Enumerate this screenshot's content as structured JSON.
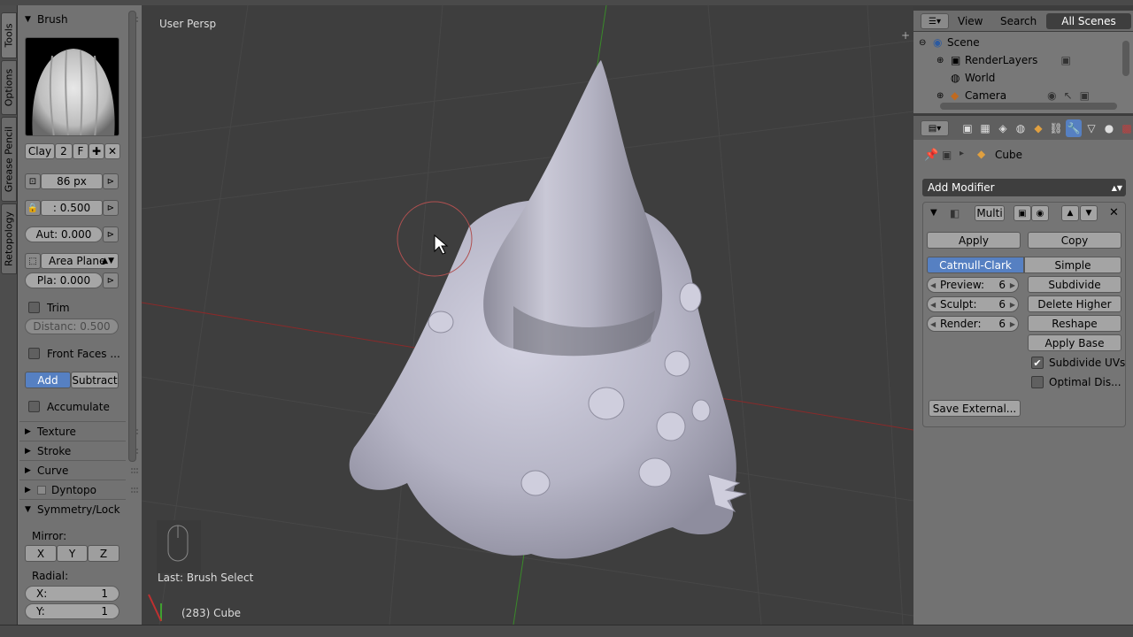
{
  "toolshelf": {
    "tabs": [
      "Tools",
      "Options",
      "Grease Pencil",
      "Retopology"
    ],
    "brush_panel": "Brush",
    "brush_name": "Clay",
    "brush_users": "2",
    "brush_fake": "F",
    "radius": "86 px",
    "strength": ": 0.500",
    "autosmooth": "Aut: 0.000",
    "sculpt_plane": "Area Plane",
    "plane_offset_label": "Pla:",
    "plane_offset_value": "0.000",
    "trim_label": "Trim",
    "distance": "Distanc: 0.500",
    "front_faces": "Front Faces ...",
    "add": "Add",
    "subtract": "Subtract",
    "accumulate": "Accumulate",
    "panels": [
      "Texture",
      "Stroke",
      "Curve",
      "Dyntopo",
      "Symmetry/Lock"
    ],
    "mirror_label": "Mirror:",
    "mirror_axes": [
      "X",
      "Y",
      "Z"
    ],
    "radial_label": "Radial:",
    "radial_x_label": "X:",
    "radial_x": "1",
    "radial_y_label": "Y:",
    "radial_y": "1"
  },
  "viewport": {
    "title": "User Persp",
    "last_op": "Last: Brush Select",
    "object": "(283) Cube"
  },
  "outliner": {
    "tabs": [
      "View",
      "Search",
      "All Scenes"
    ],
    "rows": [
      "Scene",
      "RenderLayers",
      "World",
      "Camera"
    ]
  },
  "properties": {
    "context_object": "Cube",
    "add_modifier": "Add Modifier",
    "modifier_name": "Multi",
    "apply": "Apply",
    "copy": "Copy",
    "catmull_clark": "Catmull-Clark",
    "simple": "Simple",
    "preview_label": "Preview:",
    "preview_value": "6",
    "sculpt_label": "Sculpt:",
    "sculpt_value": "6",
    "render_label": "Render:",
    "render_value": "6",
    "subdivide": "Subdivide",
    "delete_higher": "Delete Higher",
    "reshape": "Reshape",
    "apply_base": "Apply Base",
    "subdivide_uvs": "Subdivide UVs",
    "optimal_display": "Optimal Dis...",
    "save_external": "Save External..."
  },
  "colors": {
    "accent": "#5680c2",
    "viewport_bg": "#3e3e3e",
    "mesh": "#b9b8c8",
    "x_axis": "#a02020",
    "y_axis": "#40a030"
  }
}
